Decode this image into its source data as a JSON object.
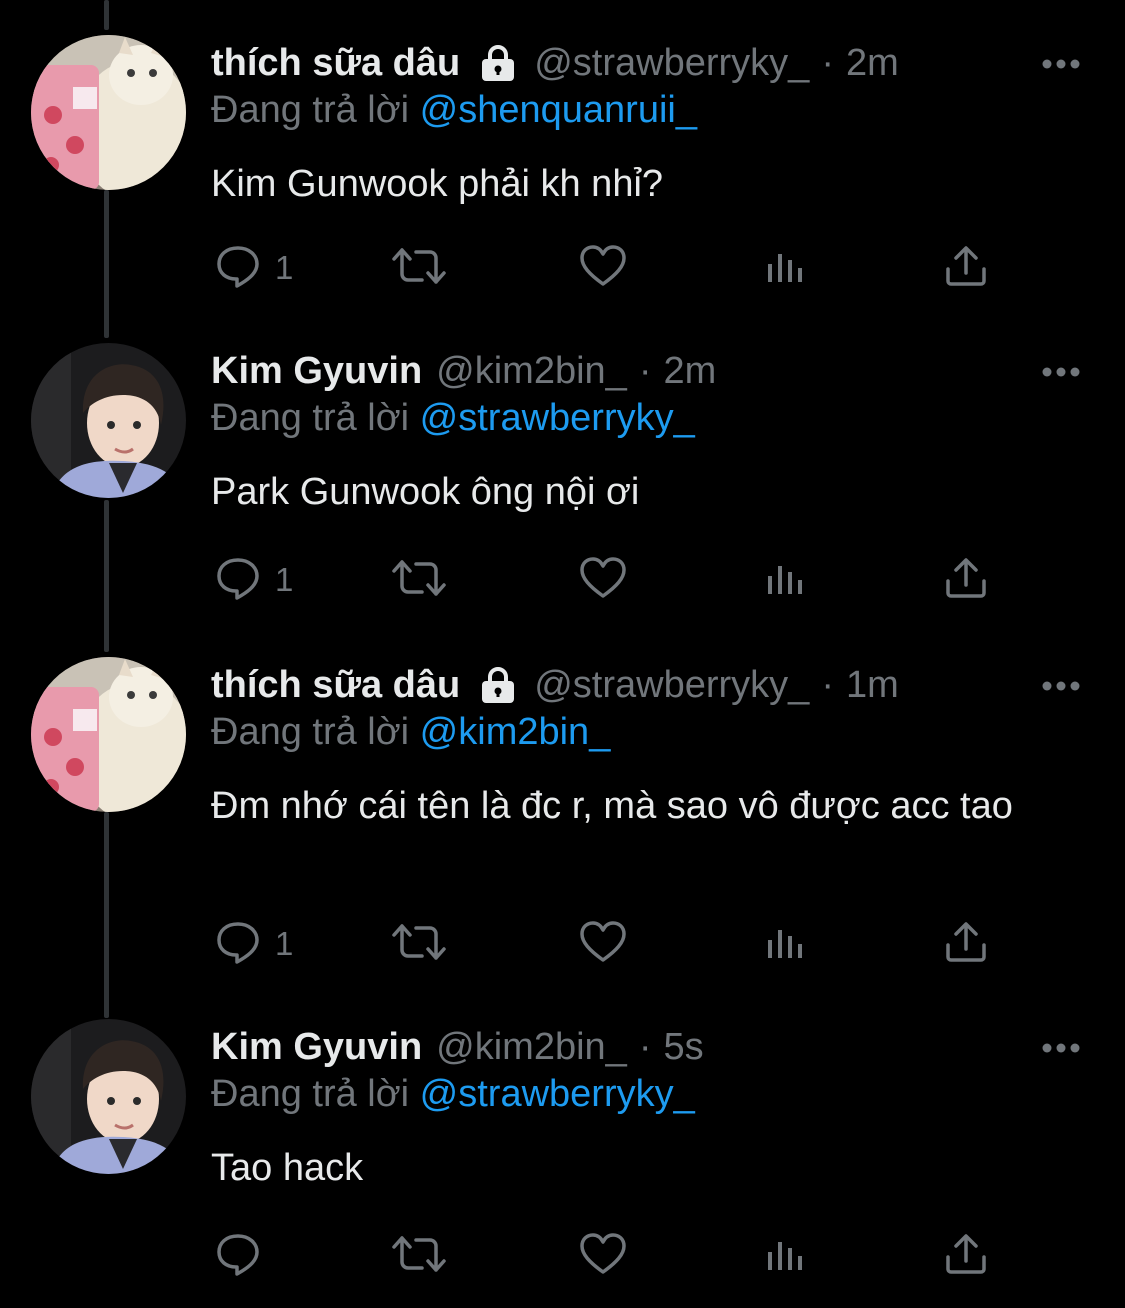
{
  "colors": {
    "background": "#000000",
    "primary_text": "#e7e9ea",
    "secondary_text": "#71767b",
    "accent": "#1d9bf0",
    "thread_line": "#2f3336"
  },
  "tweets": [
    {
      "display_name": "thích sữa dâu",
      "protected": true,
      "handle": "@strawberryky_",
      "separator": "·",
      "time": "2m",
      "reply_label": "Đang trả lời",
      "reply_to": "@shenquanruii_",
      "text": "Kim Gunwook phải kh nhỉ?",
      "reply_count": "1",
      "avatar": "cat-avatar"
    },
    {
      "display_name": "Kim Gyuvin",
      "protected": false,
      "handle": "@kim2bin_",
      "separator": "·",
      "time": "2m",
      "reply_label": "Đang trả lời",
      "reply_to": "@strawberryky_",
      "text": "Park Gunwook ông nội ơi",
      "reply_count": "1",
      "avatar": "boy-avatar"
    },
    {
      "display_name": "thích sữa dâu",
      "protected": true,
      "handle": "@strawberryky_",
      "separator": "·",
      "time": "1m",
      "reply_label": "Đang trả lời",
      "reply_to": "@kim2bin_",
      "text": "Đm nhớ cái tên là đc r, mà sao vô được acc tao",
      "reply_count": "1",
      "avatar": "cat-avatar"
    },
    {
      "display_name": "Kim Gyuvin",
      "protected": false,
      "handle": "@kim2bin_",
      "separator": "·",
      "time": "5s",
      "reply_label": "Đang trả lời",
      "reply_to": "@strawberryky_",
      "text": "Tao hack",
      "reply_count": "",
      "avatar": "boy-avatar"
    }
  ],
  "icons": {
    "more": "more-horizontal-icon",
    "lock": "lock-icon",
    "reply": "reply-icon",
    "retweet": "retweet-icon",
    "like": "heart-icon",
    "views": "views-icon",
    "share": "share-icon"
  }
}
